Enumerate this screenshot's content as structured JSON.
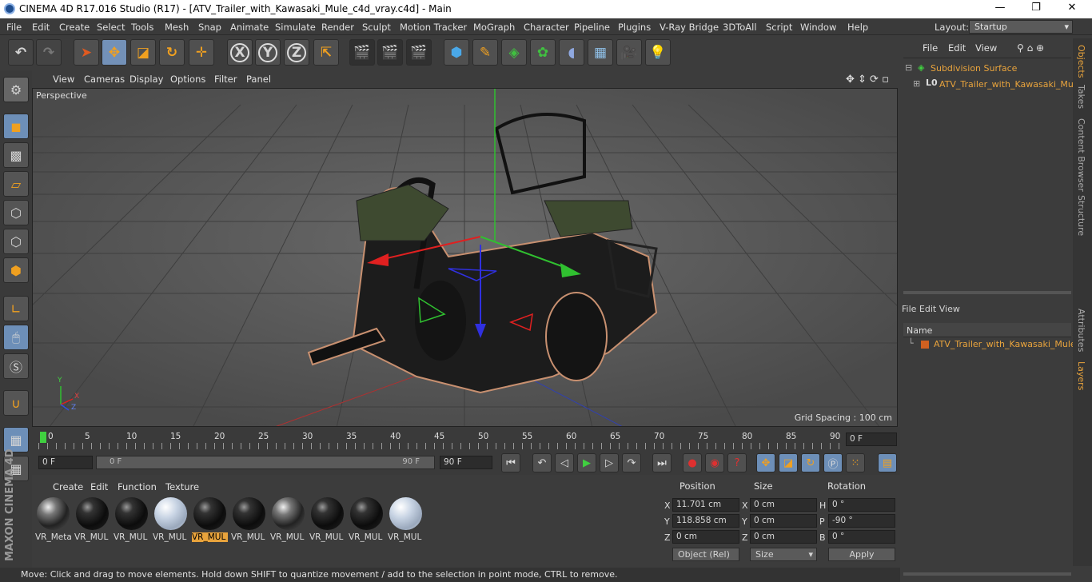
{
  "window": {
    "title": "CINEMA 4D R17.016 Studio (R17) - [ATV_Trailer_with_Kawasaki_Mule_c4d_vray.c4d] - Main",
    "minimize": "—",
    "maximize": "❐",
    "close": "✕"
  },
  "menu": [
    "File",
    "Edit",
    "Create",
    "Select",
    "Tools",
    "Mesh",
    "Snap",
    "Animate",
    "Simulate",
    "Render",
    "Sculpt",
    "Motion Tracker",
    "MoGraph",
    "Character",
    "Pipeline",
    "Plugins",
    "V-Ray Bridge",
    "3DToAll",
    "Script",
    "Window",
    "Help"
  ],
  "layout": {
    "label": "Layout:",
    "value": "Startup"
  },
  "toolbar": {
    "axis_x": "X",
    "axis_y": "Y",
    "axis_z": "Z"
  },
  "viewport": {
    "menu": [
      "View",
      "Cameras",
      "Display",
      "Options",
      "Filter",
      "Panel"
    ],
    "label": "Perspective",
    "grid_spacing": "Grid Spacing : 100 cm",
    "axis_y": "Y",
    "axis_x": "X",
    "axis_z": "Z"
  },
  "timeline": {
    "ticks": [
      "0",
      "5",
      "10",
      "15",
      "20",
      "25",
      "30",
      "35",
      "40",
      "45",
      "50",
      "55",
      "60",
      "65",
      "70",
      "75",
      "80",
      "85",
      "90"
    ],
    "current": "0 F"
  },
  "transport": {
    "start": "0 F",
    "slider_start": "0 F",
    "slider_end": "90 F",
    "end": "90 F"
  },
  "materials": {
    "menu": [
      "Create",
      "Edit",
      "Function",
      "Texture"
    ],
    "items": [
      {
        "label": "VR_Meta",
        "style": "metal",
        "selected": false
      },
      {
        "label": "VR_MUL",
        "style": "dark",
        "selected": false
      },
      {
        "label": "VR_MUL",
        "style": "dark",
        "selected": false
      },
      {
        "label": "VR_MUL",
        "style": "glass",
        "selected": false
      },
      {
        "label": "VR_MUL",
        "style": "dark",
        "selected": true
      },
      {
        "label": "VR_MUL",
        "style": "dark",
        "selected": false
      },
      {
        "label": "VR_MUL",
        "style": "metal",
        "selected": false
      },
      {
        "label": "VR_MUL",
        "style": "dark",
        "selected": false
      },
      {
        "label": "VR_MUL",
        "style": "dark",
        "selected": false
      },
      {
        "label": "VR_MUL",
        "style": "glass",
        "selected": false
      }
    ]
  },
  "attributes": {
    "position_header": "Position",
    "size_header": "Size",
    "rotation_header": "Rotation",
    "pos": [
      {
        "axis": "X",
        "value": "11.701 cm"
      },
      {
        "axis": "Y",
        "value": "118.858 cm"
      },
      {
        "axis": "Z",
        "value": "0 cm"
      }
    ],
    "size": [
      {
        "axis": "X",
        "value": "0 cm"
      },
      {
        "axis": "Y",
        "value": "0 cm"
      },
      {
        "axis": "Z",
        "value": "0 cm"
      }
    ],
    "rot": [
      {
        "axis": "H",
        "value": "0 °"
      },
      {
        "axis": "P",
        "value": "-90 °"
      },
      {
        "axis": "B",
        "value": "0 °"
      }
    ],
    "coord_mode": "Object (Rel)",
    "size_mode": "Size",
    "apply": "Apply"
  },
  "objects": {
    "menu": [
      "File",
      "Edit",
      "View"
    ],
    "items": [
      {
        "name": "Subdivision Surface"
      },
      {
        "name": "ATV_Trailer_with_Kawasaki_Mule"
      }
    ]
  },
  "layers": {
    "menu": [
      "File",
      "Edit",
      "View"
    ],
    "column": "Name",
    "items": [
      {
        "name": "ATV_Trailer_with_Kawasaki_Mule"
      }
    ]
  },
  "right_tabs": [
    "Objects",
    "Takes",
    "Content Browser",
    "Structure",
    "Attributes",
    "Layers"
  ],
  "status": "Move: Click and drag to move elements. Hold down SHIFT to quantize movement / add to the selection in point mode, CTRL to remove.",
  "brand": "MAXON CINEMA 4D",
  "colors": {
    "accent": "#e8a33c",
    "selected_tool": "#7391b8",
    "viewport_bg": "#555555",
    "selected_object": "#e8a33c"
  }
}
